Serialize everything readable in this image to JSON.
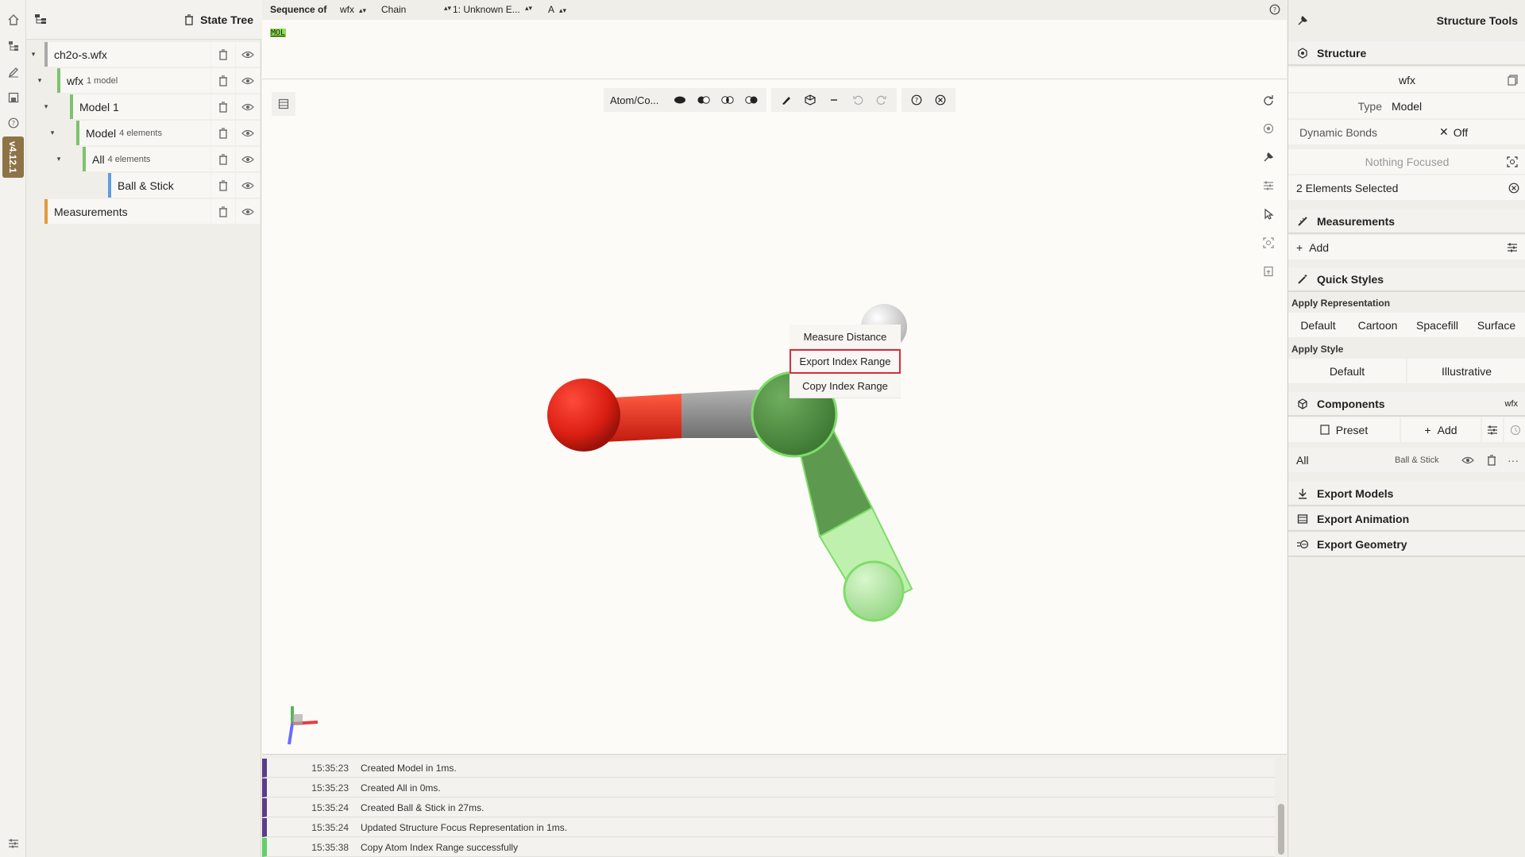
{
  "left_rail": {
    "version": "v4.12.1",
    "icons": [
      "home-icon",
      "tree-icon",
      "pencil-icon",
      "save-icon",
      "help-icon",
      "settings-sliders-icon"
    ]
  },
  "state_tree": {
    "title": "State Tree",
    "rows": [
      {
        "label": "ch2o-s.wfx",
        "sub": "",
        "color": "#a9a9a9"
      },
      {
        "label": "wfx",
        "sub": "1 model",
        "color": "#7ec26f"
      },
      {
        "label": "Model 1",
        "sub": "",
        "color": "#7ec26f"
      },
      {
        "label": "Model",
        "sub": "4 elements",
        "color": "#7ec26f"
      },
      {
        "label": "All",
        "sub": "4 elements",
        "color": "#7ec26f"
      },
      {
        "label": "Ball & Stick",
        "sub": "",
        "color": "#5d9ee0"
      },
      {
        "label": "Measurements",
        "sub": "",
        "color": "#e09a3c"
      }
    ]
  },
  "sequence": {
    "label": "Sequence of",
    "structure": "wfx",
    "mode": "Chain",
    "entity": "1: Unknown E...",
    "chain": "A",
    "mol_tag": "MOL"
  },
  "toolbar": {
    "selection_mode": "Atom/Co..."
  },
  "context_menu": {
    "items": [
      "Measure Distance",
      "Export Index Range",
      "Copy Index Range"
    ],
    "highlight_color": "#d0303c"
  },
  "log": {
    "entries": [
      {
        "time": "15:35:23",
        "message": "Created Model in 1ms."
      },
      {
        "time": "15:35:23",
        "message": "Created All in 0ms."
      },
      {
        "time": "15:35:24",
        "message": "Created Ball & Stick in 27ms."
      },
      {
        "time": "15:35:24",
        "message": "Updated Structure Focus Representation in 1ms."
      },
      {
        "time": "15:35:38",
        "message": "Copy Atom Index Range successfully"
      }
    ]
  },
  "right_panel": {
    "title": "Structure Tools",
    "structure": {
      "heading": "Structure",
      "name": "wfx",
      "type_label": "Type",
      "type_value": "Model",
      "dynamic_bonds_label": "Dynamic Bonds",
      "dynamic_bonds_value": "Off",
      "focus": "Nothing Focused",
      "selection": "2 Elements Selected"
    },
    "measurements": {
      "heading": "Measurements",
      "add": "Add"
    },
    "quick_styles": {
      "heading": "Quick Styles",
      "apply_rep_label": "Apply Representation",
      "reps": [
        "Default",
        "Cartoon",
        "Spacefill",
        "Surface"
      ],
      "apply_style_label": "Apply Style",
      "styles": [
        "Default",
        "Illustrative"
      ]
    },
    "components": {
      "heading": "Components",
      "tag": "wfx",
      "preset": "Preset",
      "add": "Add",
      "row_label": "All",
      "row_rep": "Ball & Stick"
    },
    "exports": [
      "Export Models",
      "Export Animation",
      "Export Geometry"
    ]
  },
  "colors": {
    "oxygen": "#e0261a",
    "carbon_selected": "#5f9a4f",
    "hydrogen": "#e8e8e8",
    "hydrogen_selected": "#b8eaa8",
    "bond_gray": "#8a8a8a",
    "accent_purple": "#5b3c88"
  }
}
